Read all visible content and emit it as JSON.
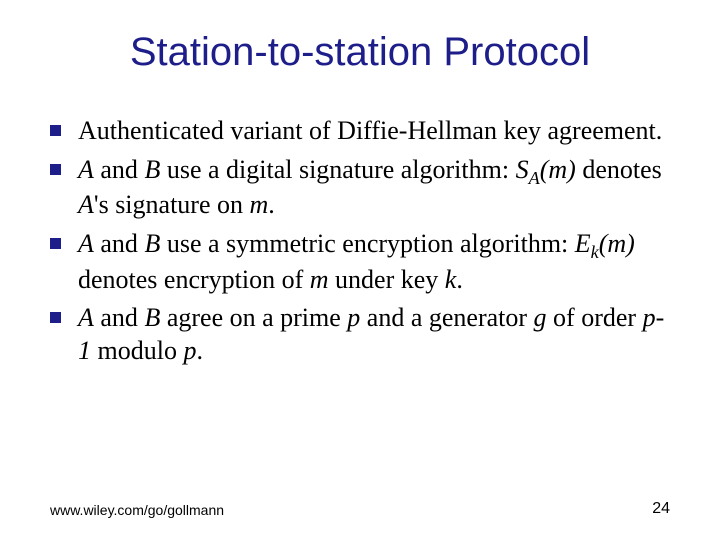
{
  "title": "Station-to-station Protocol",
  "bullets": [
    {
      "pre": "Authenticated variant of Diffie-Hellman key agreement."
    },
    {
      "pre": "",
      "A": "A",
      "t1": " and ",
      "B": "B",
      "t2": " use a digital signature algorithm: ",
      "S": "S",
      "Asub": "A",
      "m1": "(m)",
      "t3": " denotes ",
      "A2": "A",
      "t4": "'s signature on ",
      "m2": "m",
      "t5": "."
    },
    {
      "A": "A",
      "t1": " and ",
      "B": "B",
      "t2": " use a symmetric encryption algorithm: ",
      "E": "E",
      "ksub": "k",
      "m1": "(m)",
      "t3": " denotes encryption of ",
      "m2": "m",
      "t4": " under key ",
      "k": "k",
      "t5": "."
    },
    {
      "A": "A",
      "t1": " and ",
      "B": "B",
      "t2": " agree on a prime ",
      "p": "p",
      "t3": " and a generator ",
      "g": "g",
      "t4": " of order ",
      "pm1": "p-1",
      "t5": " modulo ",
      "p2": "p",
      "t6": "."
    }
  ],
  "footer": {
    "left": "www.wiley.com/go/gollmann",
    "right": "24"
  }
}
